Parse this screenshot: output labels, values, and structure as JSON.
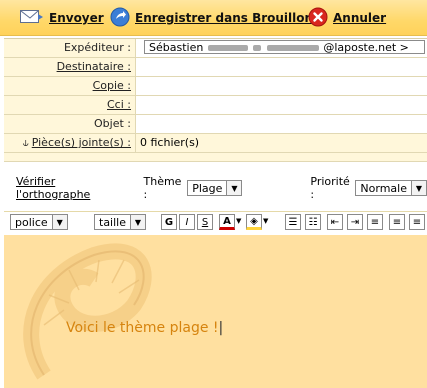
{
  "toolbar": {
    "send_label": "Envoyer",
    "save_draft_label": "Enregistrer dans Brouillons",
    "cancel_label": "Annuler"
  },
  "form": {
    "from_label": "Expéditeur :",
    "from_value_prefix": "Sébastien",
    "from_value_suffix": "@laposte.net >",
    "to_label": "Destinataire :",
    "cc_label": "Copie :",
    "bcc_label": "Cci :",
    "subject_label": "Objet :",
    "attachments_label": "Pièce(s) jointe(s) :",
    "attachments_value": "0 fichier(s)"
  },
  "options": {
    "spellcheck_label": "Vérifier l'orthographe",
    "theme_label": "Thème :",
    "theme_value": "Plage",
    "priority_label": "Priorité :",
    "priority_value": "Normale"
  },
  "format": {
    "font_value": "police",
    "size_value": "taille",
    "bold": "G",
    "italic": "I",
    "underline": "S",
    "font_color": "A"
  },
  "editor": {
    "text": "Voici le thème plage !",
    "text_color": "#d6840f",
    "background_color": "#ffe0a0"
  }
}
